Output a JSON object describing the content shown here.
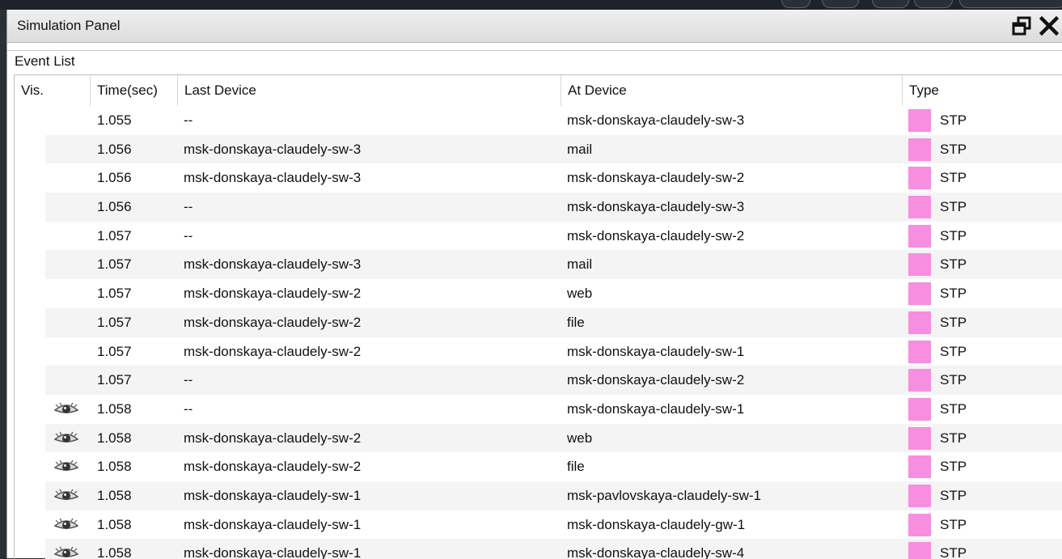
{
  "panel": {
    "title": "Simulation Panel",
    "restore_icon": "restore-window-icon",
    "close_icon": "close-icon"
  },
  "event_list": {
    "label": "Event List",
    "columns": [
      "Vis.",
      "Time(sec)",
      "Last Device",
      "At Device",
      "Type"
    ],
    "type_color": "#f78ee0",
    "rows": [
      {
        "visible": false,
        "time": "1.055",
        "last": "--",
        "at": "msk-donskaya-claudely-sw-3",
        "type": "STP"
      },
      {
        "visible": false,
        "time": "1.056",
        "last": "msk-donskaya-claudely-sw-3",
        "at": "mail",
        "type": "STP"
      },
      {
        "visible": false,
        "time": "1.056",
        "last": "msk-donskaya-claudely-sw-3",
        "at": "msk-donskaya-claudely-sw-2",
        "type": "STP"
      },
      {
        "visible": false,
        "time": "1.056",
        "last": "--",
        "at": "msk-donskaya-claudely-sw-3",
        "type": "STP"
      },
      {
        "visible": false,
        "time": "1.057",
        "last": "--",
        "at": "msk-donskaya-claudely-sw-2",
        "type": "STP"
      },
      {
        "visible": false,
        "time": "1.057",
        "last": "msk-donskaya-claudely-sw-3",
        "at": "mail",
        "type": "STP"
      },
      {
        "visible": false,
        "time": "1.057",
        "last": "msk-donskaya-claudely-sw-2",
        "at": "web",
        "type": "STP"
      },
      {
        "visible": false,
        "time": "1.057",
        "last": "msk-donskaya-claudely-sw-2",
        "at": "file",
        "type": "STP"
      },
      {
        "visible": false,
        "time": "1.057",
        "last": "msk-donskaya-claudely-sw-2",
        "at": "msk-donskaya-claudely-sw-1",
        "type": "STP"
      },
      {
        "visible": false,
        "time": "1.057",
        "last": "--",
        "at": "msk-donskaya-claudely-sw-2",
        "type": "STP"
      },
      {
        "visible": true,
        "time": "1.058",
        "last": "--",
        "at": "msk-donskaya-claudely-sw-1",
        "type": "STP"
      },
      {
        "visible": true,
        "time": "1.058",
        "last": "msk-donskaya-claudely-sw-2",
        "at": "web",
        "type": "STP"
      },
      {
        "visible": true,
        "time": "1.058",
        "last": "msk-donskaya-claudely-sw-2",
        "at": "file",
        "type": "STP"
      },
      {
        "visible": true,
        "time": "1.058",
        "last": "msk-donskaya-claudely-sw-1",
        "at": "msk-pavlovskaya-claudely-sw-1",
        "type": "STP"
      },
      {
        "visible": true,
        "time": "1.058",
        "last": "msk-donskaya-claudely-sw-1",
        "at": "msk-donskaya-claudely-gw-1",
        "type": "STP"
      },
      {
        "visible": true,
        "time": "1.058",
        "last": "msk-donskaya-claudely-sw-1",
        "at": "msk-donskaya-claudely-sw-4",
        "type": "STP"
      }
    ]
  }
}
